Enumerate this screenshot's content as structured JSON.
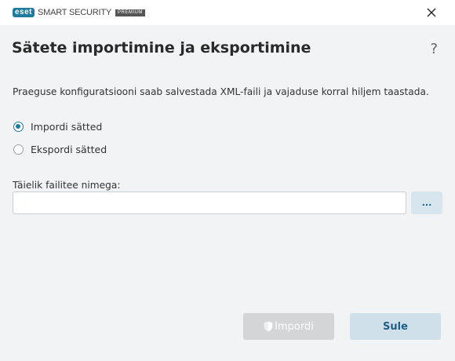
{
  "window": {
    "brand_badge": "eset",
    "product_name": "SMART SECURITY",
    "edition_badge": "PREMIUM"
  },
  "dialog": {
    "title": "Sätete importimine ja eksportimine",
    "help_label": "?",
    "description": "Praeguse konfiguratsiooni saab salvestada XML-faili ja vajaduse korral hiljem taastada.",
    "options": [
      {
        "label": "Impordi sätted",
        "selected": true
      },
      {
        "label": "Ekspordi sätted",
        "selected": false
      }
    ],
    "path_label": "Täielik failitee nimega:",
    "path_value": "",
    "browse_label": "...",
    "import_label": "Impordi",
    "close_label": "Sule"
  },
  "icons": {
    "close": "close-icon",
    "shield": "shield-icon"
  },
  "colors": {
    "accent": "#1f7a9e",
    "disabled_button": "#d3d5d7",
    "secondary_button": "#cfe0eb"
  }
}
